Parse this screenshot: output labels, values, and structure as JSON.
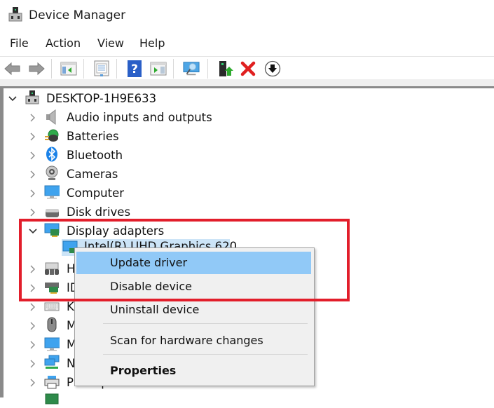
{
  "window": {
    "title": "Device Manager",
    "icon": "device-manager-icon"
  },
  "menubar": {
    "items": [
      "File",
      "Action",
      "View",
      "Help"
    ]
  },
  "toolbar": {
    "buttons": [
      {
        "name": "back",
        "icon": "back-arrow-icon"
      },
      {
        "name": "forward",
        "icon": "forward-arrow-icon"
      },
      {
        "name": "show-hide-console-tree",
        "icon": "console-tree-icon"
      },
      {
        "name": "properties",
        "icon": "properties-sheet-icon"
      },
      {
        "name": "help",
        "icon": "help-icon"
      },
      {
        "name": "show-action-pane",
        "icon": "action-pane-icon"
      },
      {
        "name": "scan-hardware",
        "icon": "scan-monitor-icon"
      },
      {
        "name": "update-driver",
        "icon": "update-driver-icon"
      },
      {
        "name": "uninstall-device",
        "icon": "red-x-icon"
      },
      {
        "name": "disable-device",
        "icon": "down-arrow-circle-icon"
      }
    ]
  },
  "tree": {
    "root": {
      "label": "DESKTOP-1H9E633",
      "expanded": true,
      "icon": "computer-tower-icon"
    },
    "categories": [
      {
        "label": "Audio inputs and outputs",
        "expanded": false,
        "icon": "speaker-icon"
      },
      {
        "label": "Batteries",
        "expanded": false,
        "icon": "battery-icon"
      },
      {
        "label": "Bluetooth",
        "expanded": false,
        "icon": "bluetooth-icon"
      },
      {
        "label": "Cameras",
        "expanded": false,
        "icon": "camera-icon"
      },
      {
        "label": "Computer",
        "expanded": false,
        "icon": "monitor-icon"
      },
      {
        "label": "Disk drives",
        "expanded": false,
        "icon": "disk-drive-icon"
      },
      {
        "label": "Display adapters",
        "expanded": true,
        "icon": "display-adapter-icon"
      },
      {
        "label": "H",
        "expanded": false,
        "icon": "hid-icon"
      },
      {
        "label": "ID",
        "expanded": false,
        "icon": "ide-controller-icon"
      },
      {
        "label": "K",
        "expanded": false,
        "icon": "keyboard-icon"
      },
      {
        "label": "M",
        "expanded": false,
        "icon": "mouse-icon"
      },
      {
        "label": "M",
        "expanded": false,
        "icon": "monitor-icon"
      },
      {
        "label": "N",
        "expanded": false,
        "icon": "network-adapter-icon"
      },
      {
        "label": "Print queues",
        "expanded": false,
        "icon": "printer-icon"
      }
    ],
    "selected_child": {
      "label": "Intel(R) UHD Graphics 620",
      "icon": "display-adapter-device-icon"
    }
  },
  "context_menu": {
    "items": [
      {
        "label": "Update driver",
        "highlighted": true,
        "bold": false
      },
      {
        "label": "Disable device",
        "highlighted": false,
        "bold": false
      },
      {
        "label": "Uninstall device",
        "highlighted": false,
        "bold": false
      },
      {
        "label": "Scan for hardware changes",
        "highlighted": false,
        "bold": false
      },
      {
        "label": "Properties",
        "highlighted": false,
        "bold": true
      }
    ]
  },
  "annotation": {
    "color": "#e21e2b"
  }
}
